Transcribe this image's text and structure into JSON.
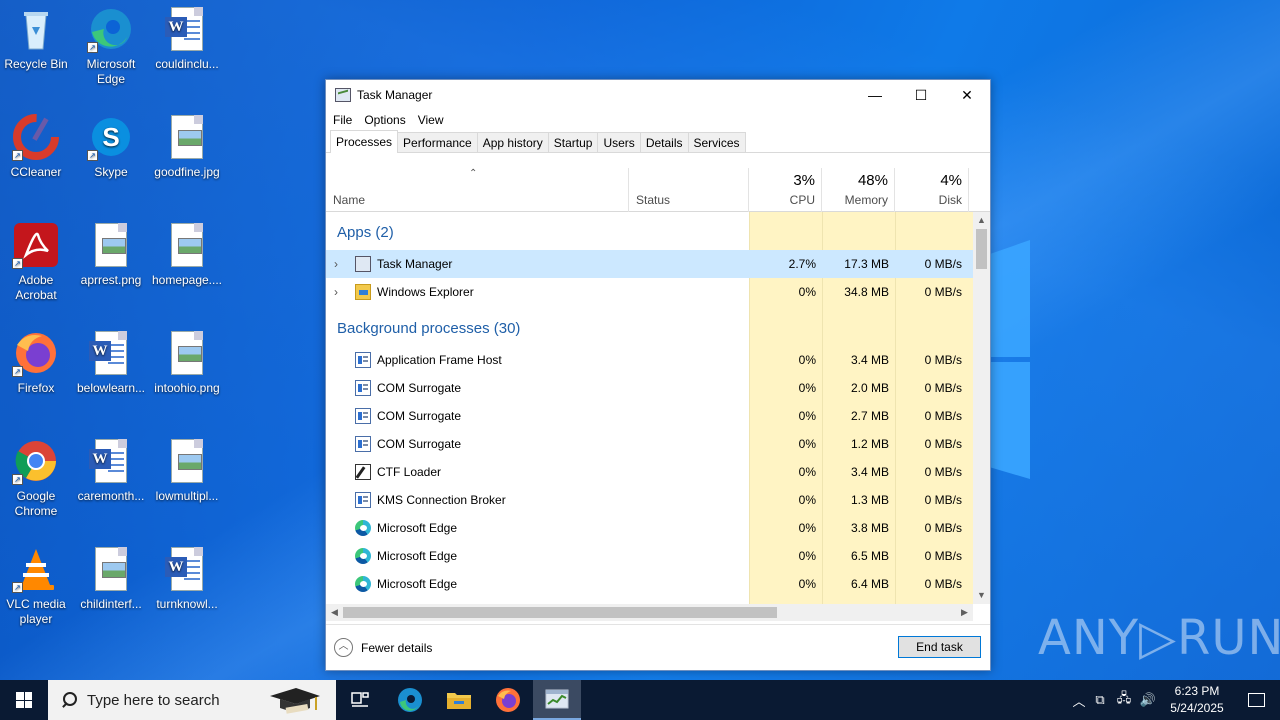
{
  "desktop": {
    "icons": [
      {
        "label": "Recycle Bin",
        "icon": "recycle-bin-icon"
      },
      {
        "label": "Microsoft Edge",
        "icon": "edge-icon"
      },
      {
        "label": "couldinclu...",
        "icon": "word-doc-icon"
      },
      {
        "label": "CCleaner",
        "icon": "ccleaner-icon"
      },
      {
        "label": "Skype",
        "icon": "skype-icon"
      },
      {
        "label": "goodfine.jpg",
        "icon": "image-file-icon"
      },
      {
        "label": "Adobe Acrobat",
        "icon": "acrobat-icon"
      },
      {
        "label": "aprrest.png",
        "icon": "image-file-icon"
      },
      {
        "label": "homepage....",
        "icon": "image-file-icon"
      },
      {
        "label": "Firefox",
        "icon": "firefox-icon"
      },
      {
        "label": "belowlearn...",
        "icon": "word-doc-icon"
      },
      {
        "label": "intoohio.png",
        "icon": "image-file-icon"
      },
      {
        "label": "Google Chrome",
        "icon": "chrome-icon"
      },
      {
        "label": "caremonth...",
        "icon": "word-doc-icon"
      },
      {
        "label": "lowmultipl...",
        "icon": "image-file-icon"
      },
      {
        "label": "VLC media player",
        "icon": "vlc-icon"
      },
      {
        "label": "childinterf...",
        "icon": "image-file-icon"
      },
      {
        "label": "turnknowl...",
        "icon": "word-doc-icon"
      }
    ]
  },
  "window": {
    "title": "Task Manager",
    "minimize": "—",
    "maximize": "☐",
    "close": "✕"
  },
  "menu": [
    "File",
    "Options",
    "View"
  ],
  "tabs": [
    "Processes",
    "Performance",
    "App history",
    "Startup",
    "Users",
    "Details",
    "Services"
  ],
  "active_tab": "Processes",
  "columns": {
    "name": "Name",
    "status": "Status",
    "cpu": {
      "pct": "3%",
      "label": "CPU"
    },
    "memory": {
      "pct": "48%",
      "label": "Memory"
    },
    "disk": {
      "pct": "4%",
      "label": "Disk"
    }
  },
  "groups": {
    "apps": "Apps (2)",
    "background": "Background processes (30)"
  },
  "apps": [
    {
      "name": "Task Manager",
      "cpu": "2.7%",
      "memory": "17.3 MB",
      "disk": "0 MB/s",
      "icon": "task-manager-icon",
      "selected": true
    },
    {
      "name": "Windows Explorer",
      "cpu": "0%",
      "memory": "34.8 MB",
      "disk": "0 MB/s",
      "icon": "explorer-icon"
    }
  ],
  "background": [
    {
      "name": "Application Frame Host",
      "cpu": "0%",
      "memory": "3.4 MB",
      "disk": "0 MB/s",
      "icon": "app-window-icon"
    },
    {
      "name": "COM Surrogate",
      "cpu": "0%",
      "memory": "2.0 MB",
      "disk": "0 MB/s",
      "icon": "app-window-icon"
    },
    {
      "name": "COM Surrogate",
      "cpu": "0%",
      "memory": "2.7 MB",
      "disk": "0 MB/s",
      "icon": "app-window-icon"
    },
    {
      "name": "COM Surrogate",
      "cpu": "0%",
      "memory": "1.2 MB",
      "disk": "0 MB/s",
      "icon": "app-window-icon"
    },
    {
      "name": "CTF Loader",
      "cpu": "0%",
      "memory": "3.4 MB",
      "disk": "0 MB/s",
      "icon": "ctf-loader-icon"
    },
    {
      "name": "KMS Connection Broker",
      "cpu": "0%",
      "memory": "1.3 MB",
      "disk": "0 MB/s",
      "icon": "app-window-icon"
    },
    {
      "name": "Microsoft Edge",
      "cpu": "0%",
      "memory": "3.8 MB",
      "disk": "0 MB/s",
      "icon": "edge-icon"
    },
    {
      "name": "Microsoft Edge",
      "cpu": "0%",
      "memory": "6.5 MB",
      "disk": "0 MB/s",
      "icon": "edge-icon"
    },
    {
      "name": "Microsoft Edge",
      "cpu": "0%",
      "memory": "6.4 MB",
      "disk": "0 MB/s",
      "icon": "edge-icon"
    }
  ],
  "footer": {
    "fewer_details": "Fewer details",
    "end_task": "End task"
  },
  "watermark": "ANY▷RUN",
  "taskbar": {
    "search_placeholder": "Type here to search",
    "time": "6:23 PM",
    "date": "5/24/2025"
  },
  "colors": {
    "accent": "#0078d7",
    "heat": "#fff4c4",
    "selected_row": "#cce8ff",
    "group_text": "#1f5fa8"
  }
}
